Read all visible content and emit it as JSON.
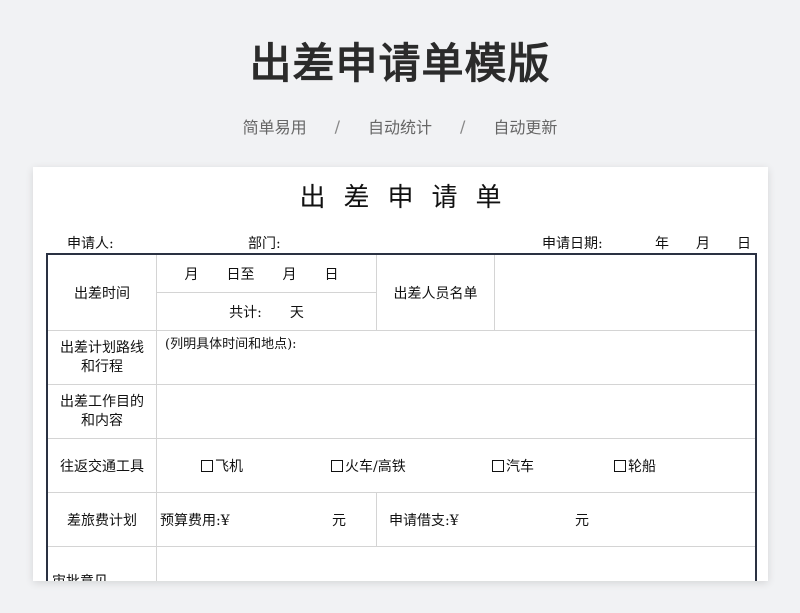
{
  "banner": {
    "title": "出差申请单模版",
    "tags": [
      "简单易用",
      "自动统计",
      "自动更新"
    ],
    "separator": "/"
  },
  "form": {
    "title": "出差申请单",
    "meta": {
      "applicant": "申请人:",
      "department": "部门:",
      "apply_date": "申请日期:",
      "year": "年",
      "month": "月",
      "day": "日"
    },
    "trip_time": {
      "label": "出差时间",
      "range": "月　　日至　　月　　日",
      "total": "共计:　　天"
    },
    "personnel": {
      "label": "出差人员名单"
    },
    "route": {
      "label_line1": "出差计划路线",
      "label_line2": "和行程",
      "hint": "(列明具体时间和地点):"
    },
    "purpose": {
      "label_line1": "出差工作目的",
      "label_line2": "和内容"
    },
    "transport": {
      "label": "往返交通工具",
      "options": [
        "飞机",
        "火车/高铁",
        "汽车",
        "轮船"
      ]
    },
    "budget": {
      "label": "差旅费计划",
      "estimate_label": "预算费用:¥",
      "estimate_unit": "元",
      "loan_label": "申请借支:¥",
      "loan_unit": "元"
    },
    "next_row_label": "审批意见"
  }
}
